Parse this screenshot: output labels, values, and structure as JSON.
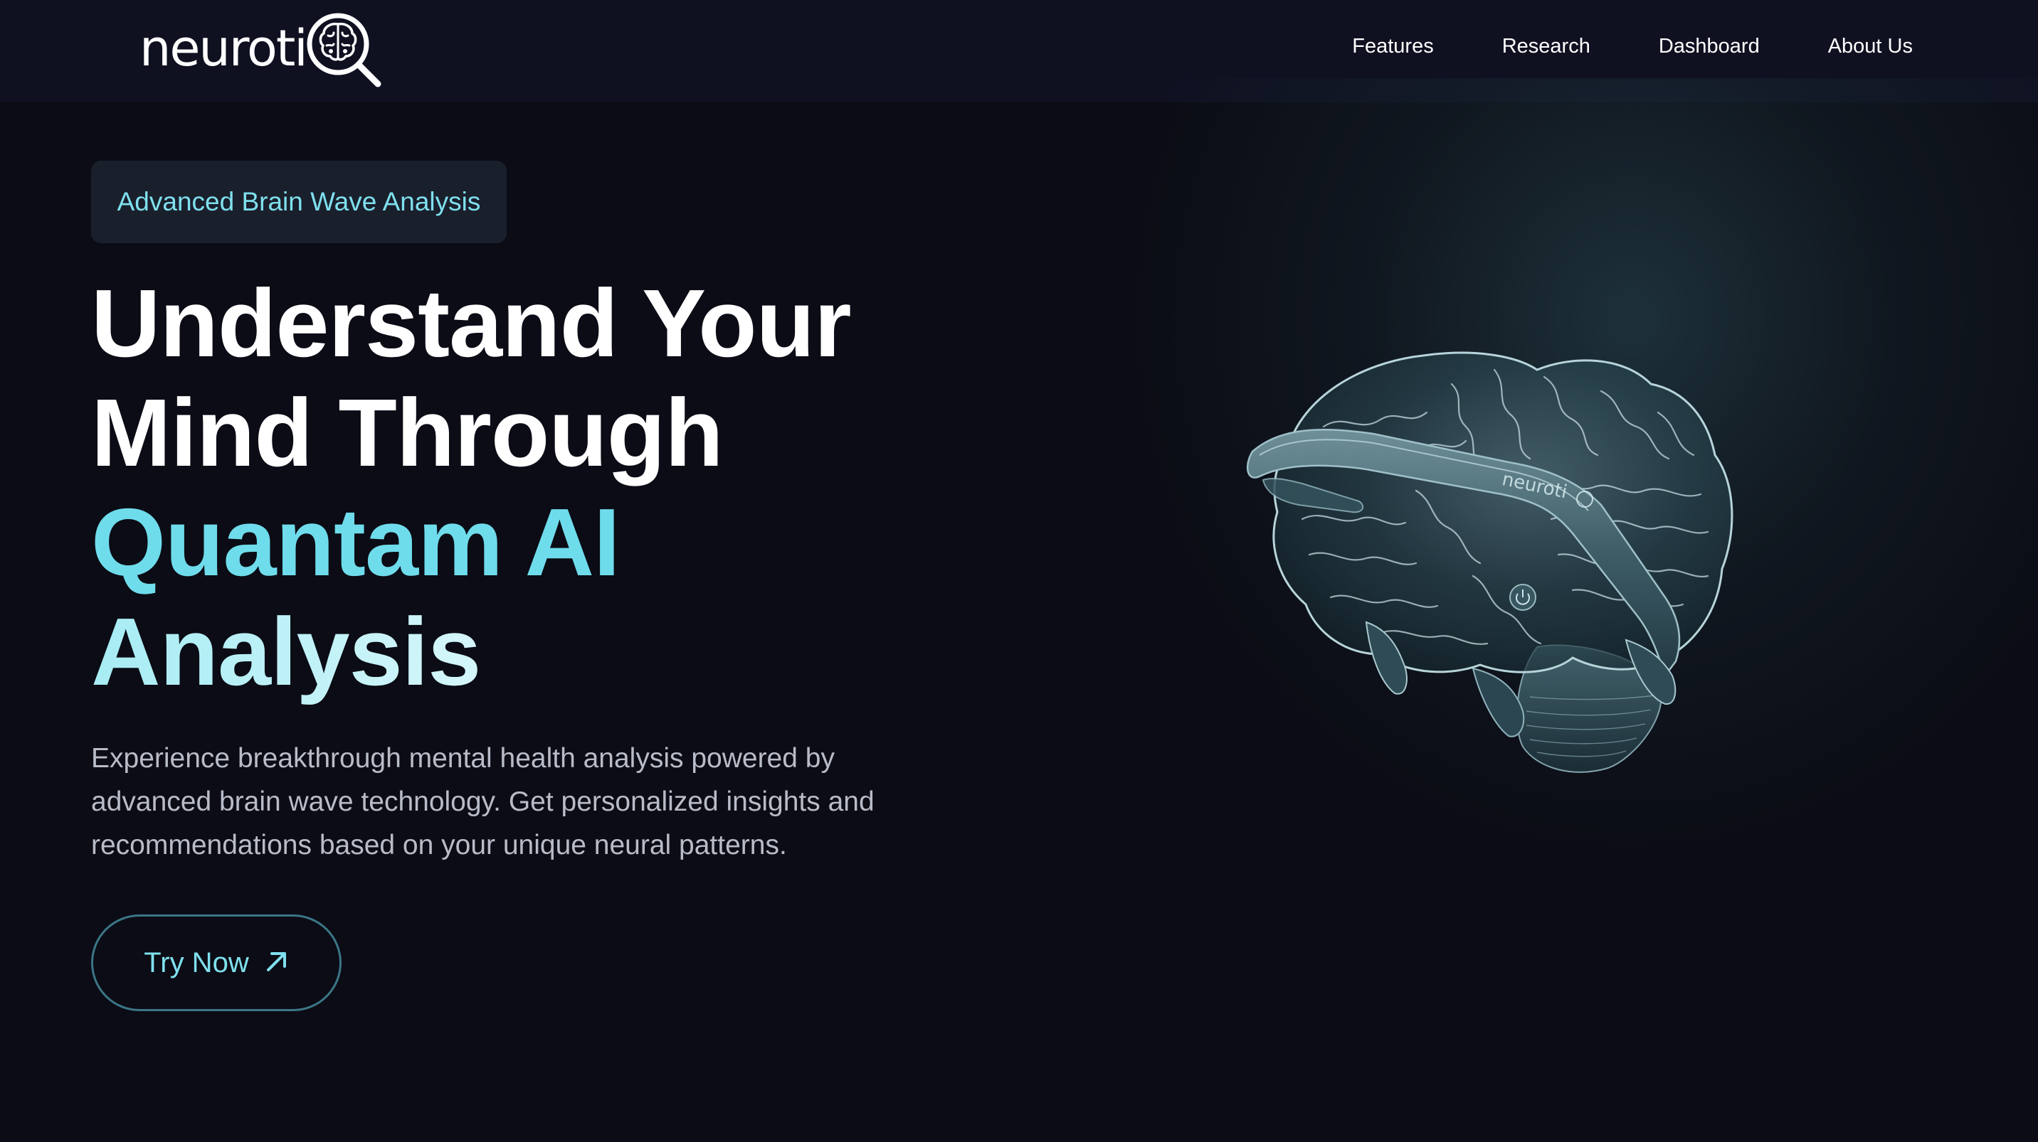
{
  "header": {
    "logo_text": "neuroti",
    "logo_icon": "brain-magnifier-icon",
    "nav": [
      {
        "label": "Features"
      },
      {
        "label": "Research"
      },
      {
        "label": "Dashboard"
      },
      {
        "label": "About Us"
      }
    ]
  },
  "hero": {
    "badge": "Advanced Brain Wave Analysis",
    "headline": {
      "line1": "Understand Your",
      "line2": "Mind Through",
      "line3": "Quantam AI",
      "line4": "Analysis"
    },
    "subtitle": "Experience breakthrough mental health analysis powered by advanced brain wave technology. Get personalized insights and recommendations based on your unique neural patterns.",
    "cta": {
      "label": "Try Now",
      "icon": "arrow-up-right-icon"
    },
    "image": {
      "device_label": "neuroti",
      "icon": "brain-headband-illustration"
    }
  },
  "colors": {
    "background": "#0b0c15",
    "header": "#0f1121",
    "accent": "#6fdcec",
    "badge_bg": "#1a1f2c",
    "cta_border": "#3b7686",
    "body_text": "#b8bcc8"
  }
}
